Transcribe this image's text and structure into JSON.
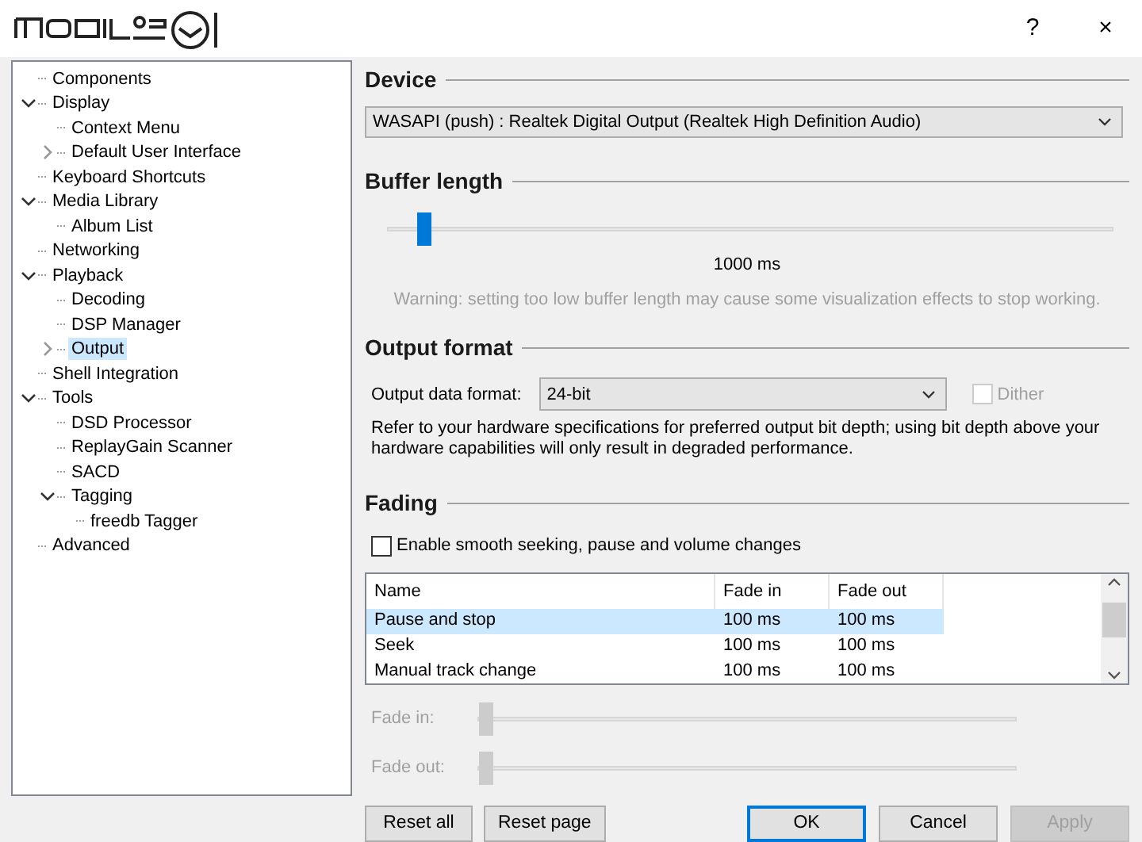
{
  "window": {
    "help_glyph": "?",
    "close_glyph": "×"
  },
  "tree": [
    {
      "label": "Components",
      "selected": false
    },
    {
      "label": "Display",
      "selected": false,
      "expanded": true,
      "children": [
        {
          "label": "Context Menu",
          "selected": false
        },
        {
          "label": "Default User Interface",
          "selected": false,
          "expanded": false
        }
      ]
    },
    {
      "label": "Keyboard Shortcuts",
      "selected": false
    },
    {
      "label": "Media Library",
      "selected": false,
      "expanded": true,
      "children": [
        {
          "label": "Album List",
          "selected": false
        }
      ]
    },
    {
      "label": "Networking",
      "selected": false
    },
    {
      "label": "Playback",
      "selected": false,
      "expanded": true,
      "children": [
        {
          "label": "Decoding",
          "selected": false
        },
        {
          "label": "DSP Manager",
          "selected": false
        },
        {
          "label": "Output",
          "selected": true,
          "expanded": false
        }
      ]
    },
    {
      "label": "Shell Integration",
      "selected": false
    },
    {
      "label": "Tools",
      "selected": false,
      "expanded": true,
      "children": [
        {
          "label": "DSD Processor",
          "selected": false
        },
        {
          "label": "ReplayGain Scanner",
          "selected": false
        },
        {
          "label": "SACD",
          "selected": false
        },
        {
          "label": "Tagging",
          "selected": false,
          "expanded": true,
          "children": [
            {
              "label": "freedb Tagger",
              "selected": false
            }
          ]
        }
      ]
    },
    {
      "label": "Advanced",
      "selected": false
    }
  ],
  "device": {
    "heading": "Device",
    "value": "WASAPI (push) : Realtek Digital Output (Realtek High Definition Audio)"
  },
  "buffer": {
    "heading": "Buffer length",
    "level": 0.04,
    "reading": "1000 ms",
    "warning": "Warning: setting too low buffer length may cause some visualization effects to stop working."
  },
  "output_format": {
    "heading": "Output format",
    "label": "Output data format:",
    "value": "24-bit",
    "dither": {
      "label": "Dither",
      "checked": false,
      "disabled": true
    },
    "note": "Refer to your hardware specifications for preferred output bit depth; using bit depth above your hardware capabilities will only result in degraded performance."
  },
  "fading": {
    "heading": "Fading",
    "enable": {
      "label": "Enable smooth seeking, pause and volume changes",
      "checked": false
    },
    "table": {
      "columns": [
        "Name",
        "Fade in",
        "Fade out"
      ],
      "rows": [
        {
          "cells": [
            "Pause and stop",
            "100 ms",
            "100 ms"
          ],
          "selected": true
        },
        {
          "cells": [
            "Seek",
            "100 ms",
            "100 ms"
          ],
          "selected": false
        },
        {
          "cells": [
            "Manual track change",
            "100 ms",
            "100 ms"
          ],
          "selected": false
        }
      ]
    },
    "sliders": [
      {
        "label": "Fade in:",
        "level": 0,
        "disabled": true
      },
      {
        "label": "Fade out:",
        "level": 0,
        "disabled": true
      }
    ]
  },
  "buttons": [
    {
      "label": "Reset all",
      "disabled": false,
      "default": false
    },
    {
      "label": "Reset page",
      "disabled": false,
      "default": false
    },
    {
      "label": "OK",
      "disabled": false,
      "default": true
    },
    {
      "label": "Cancel",
      "disabled": false,
      "default": false
    },
    {
      "label": "Apply",
      "disabled": true,
      "default": false
    }
  ]
}
